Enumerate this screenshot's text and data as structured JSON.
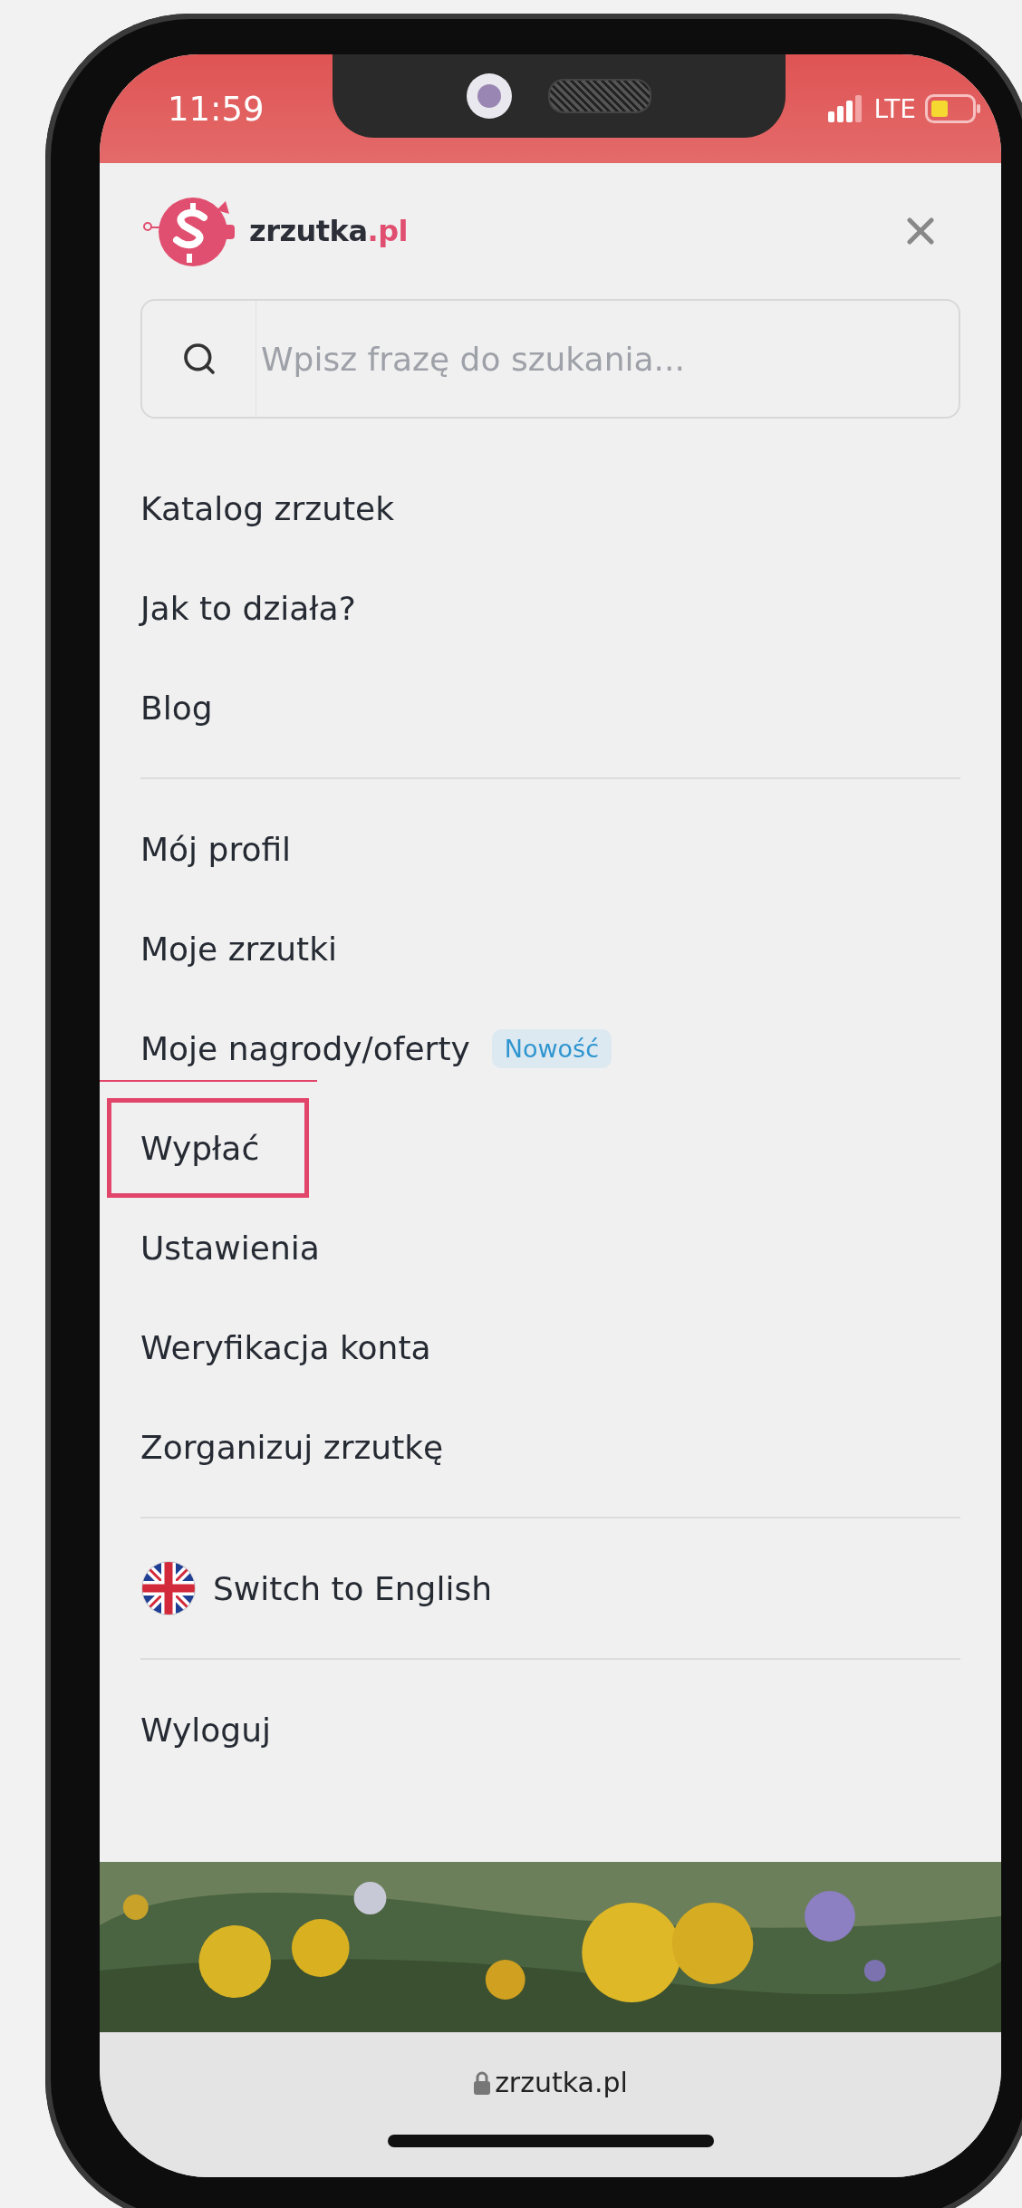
{
  "status_bar": {
    "time": "11:59",
    "network": "LTE"
  },
  "header": {
    "logo_name": "zrzutka",
    "logo_domain": ".pl"
  },
  "search": {
    "placeholder": "Wpisz frazę do szukania..."
  },
  "menu_groups": [
    {
      "items": [
        {
          "kind": "link",
          "label": "Katalog zrzutek",
          "highlighted": false
        },
        {
          "kind": "link",
          "label": "Jak to działa?",
          "highlighted": false
        },
        {
          "kind": "link",
          "label": "Blog",
          "highlighted": false
        }
      ]
    },
    {
      "items": [
        {
          "kind": "link",
          "label": "Mój profil",
          "highlighted": false
        },
        {
          "kind": "link",
          "label": "Moje zrzutki",
          "highlighted": false
        },
        {
          "kind": "link",
          "label": "Moje nagrody/oferty",
          "badge": "Nowość",
          "highlighted": false
        },
        {
          "kind": "link",
          "label": "Wypłać",
          "highlighted": true
        },
        {
          "kind": "link",
          "label": "Ustawienia",
          "highlighted": false
        },
        {
          "kind": "link",
          "label": "Weryfikacja konta",
          "highlighted": false
        },
        {
          "kind": "link",
          "label": "Zorganizuj zrzutkę",
          "highlighted": false
        }
      ]
    },
    {
      "items": [
        {
          "kind": "language",
          "label": "Switch to English",
          "highlighted": false
        }
      ]
    },
    {
      "items": [
        {
          "kind": "link",
          "label": "Wyloguj",
          "highlighted": false
        }
      ]
    }
  ],
  "url_bar": {
    "address": "zrzutka.pl"
  }
}
